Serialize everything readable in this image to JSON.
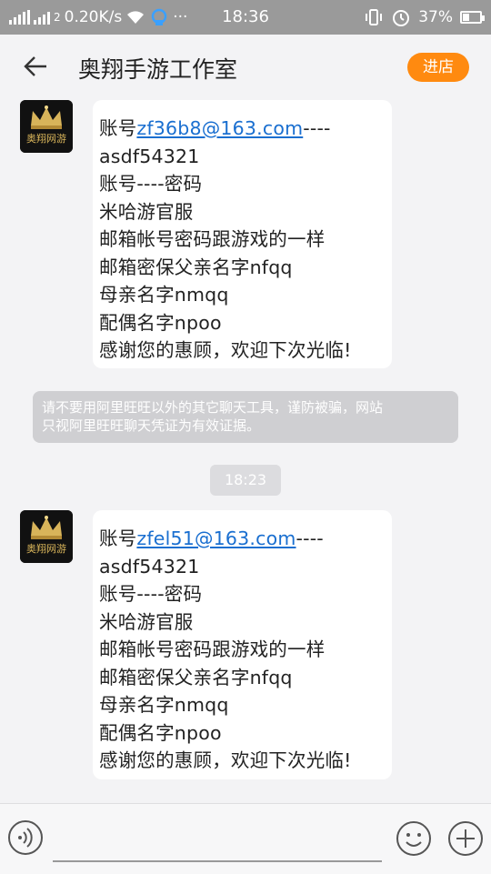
{
  "status_bar": {
    "network_speed": "0.20K/s",
    "sim_label": "2",
    "dots": "···",
    "time": "18:36",
    "battery": "37%",
    "battery_level": 0.37
  },
  "header": {
    "title": "奥翔手游工作室",
    "shop_label": "进店"
  },
  "avatar": {
    "logo_text": "奥翔网游"
  },
  "messages": [
    {
      "lines": [
        {
          "prefix": "账号",
          "link": "zf36b8@163.com",
          "suffix": "----"
        },
        {
          "text": "asdf54321"
        },
        {
          "text": "账号----密码"
        },
        {
          "text": "米哈游官服"
        },
        {
          "text": "邮箱帐号密码跟游戏的一样"
        },
        {
          "text": "邮箱密保父亲名字nfqq"
        },
        {
          "text": "母亲名字nmqq"
        },
        {
          "text": "配偶名字npoo"
        },
        {
          "text": "感谢您的惠顾，欢迎下次光临!"
        }
      ]
    },
    {
      "lines": [
        {
          "prefix": "账号",
          "link": "zfel51@163.com",
          "suffix": "----"
        },
        {
          "text": "asdf54321"
        },
        {
          "text": "账号----密码"
        },
        {
          "text": "米哈游官服"
        },
        {
          "text": "邮箱帐号密码跟游戏的一样"
        },
        {
          "text": "邮箱密保父亲名字nfqq"
        },
        {
          "text": "母亲名字nmqq"
        },
        {
          "text": "配偶名字npoo"
        },
        {
          "text": "感谢您的惠顾，欢迎下次光临!"
        }
      ]
    }
  ],
  "notice": {
    "line1": "请不要用阿里旺旺以外的其它聊天工具，谨防被骗，网站",
    "line2": "只视阿里旺旺聊天凭证为有效证据。"
  },
  "timestamp": "18:23",
  "input": {
    "placeholder": ""
  },
  "colors": {
    "accent": "#ff8a10",
    "link": "#1a6fd0",
    "background": "#f3f3f5",
    "status_bar": "#9a9a9a"
  },
  "icons": [
    "back-arrow-icon",
    "voice-icon",
    "emoji-icon",
    "plus-icon",
    "wifi-icon",
    "alarm-icon",
    "vibrate-icon"
  ]
}
